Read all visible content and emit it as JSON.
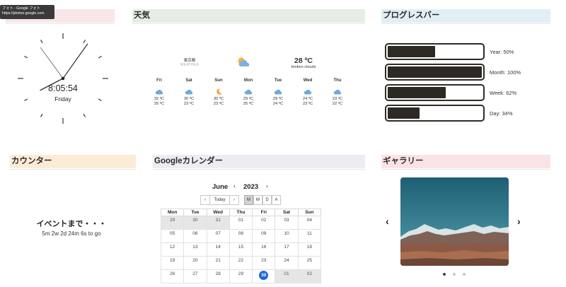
{
  "tooltip": {
    "title": "フォト - Google フォト",
    "url": "https://photos.google.com"
  },
  "sections": {
    "clock": "",
    "weather": "天気",
    "progress": "プログレスバー",
    "counter": "カウンター",
    "calendar": "Googleカレンダー",
    "gallery": "ギャラリー"
  },
  "clock": {
    "time": "8:05:54",
    "day": "Friday",
    "hour": 8,
    "minute": 5,
    "second": 54
  },
  "weather": {
    "location": "東京都",
    "location_sub": "WEATHER",
    "temp": "28 ºC",
    "description": "broken clouds",
    "main_icon": "partly-cloudy-icon",
    "days": [
      {
        "name": "Fri",
        "icon": "cloud-icon",
        "hi": "32 ºC",
        "lo": "25 ºC"
      },
      {
        "name": "Sat",
        "icon": "cloud-icon",
        "hi": "30 ºC",
        "lo": "23 ºC"
      },
      {
        "name": "Sun",
        "icon": "moon-icon",
        "hi": "30 ºC",
        "lo": "23 ºC"
      },
      {
        "name": "Mon",
        "icon": "cloud-icon",
        "hi": "29 ºC",
        "lo": "25 ºC"
      },
      {
        "name": "Tue",
        "icon": "cloud-icon",
        "hi": "29 ºC",
        "lo": "24 ºC"
      },
      {
        "name": "Wed",
        "icon": "cloud-icon",
        "hi": "24 ºC",
        "lo": "23 ºC"
      },
      {
        "name": "Thu",
        "icon": "cloud-icon",
        "hi": "23 ºC",
        "lo": "22 ºC"
      }
    ]
  },
  "progress": [
    {
      "label": "Year: 50%",
      "value": 0.5
    },
    {
      "label": "Month: 100%",
      "value": 1.0
    },
    {
      "label": "Week: 62%",
      "value": 0.62
    },
    {
      "label": "Day: 34%",
      "value": 0.34
    }
  ],
  "counter": {
    "title": "イベントまで・・・",
    "remaining": "5m 2w 2d 24m 6s to go"
  },
  "calendar": {
    "month": "June",
    "year": "2023",
    "prev": "‹",
    "next": "›",
    "today_label": "Today",
    "views": [
      {
        "label": "M",
        "active": true
      },
      {
        "label": "W",
        "active": false
      },
      {
        "label": "D",
        "active": false
      },
      {
        "label": "A",
        "active": false
      }
    ],
    "weekdays": [
      "Mon",
      "Tue",
      "Wed",
      "Thu",
      "Fri",
      "Sat",
      "Sun"
    ],
    "weeks": [
      [
        {
          "d": "29",
          "m": true
        },
        {
          "d": "30",
          "m": true
        },
        {
          "d": "31",
          "m": true
        },
        {
          "d": "01"
        },
        {
          "d": "02"
        },
        {
          "d": "03"
        },
        {
          "d": "04"
        }
      ],
      [
        {
          "d": "05"
        },
        {
          "d": "06"
        },
        {
          "d": "07"
        },
        {
          "d": "08"
        },
        {
          "d": "09"
        },
        {
          "d": "10"
        },
        {
          "d": "11"
        }
      ],
      [
        {
          "d": "12"
        },
        {
          "d": "13"
        },
        {
          "d": "14"
        },
        {
          "d": "15"
        },
        {
          "d": "16"
        },
        {
          "d": "17"
        },
        {
          "d": "18"
        }
      ],
      [
        {
          "d": "19"
        },
        {
          "d": "20"
        },
        {
          "d": "21"
        },
        {
          "d": "22"
        },
        {
          "d": "23"
        },
        {
          "d": "24"
        },
        {
          "d": "25"
        }
      ],
      [
        {
          "d": "26"
        },
        {
          "d": "27"
        },
        {
          "d": "28"
        },
        {
          "d": "29"
        },
        {
          "d": "30",
          "today": true
        },
        {
          "d": "01",
          "m": true
        },
        {
          "d": "02",
          "m": true
        }
      ]
    ]
  },
  "gallery": {
    "prev": "‹",
    "next": "›",
    "slide_count": 3,
    "active_slide": 0
  },
  "colors": {
    "clock_head": "#f8e6e8",
    "weather_head": "#e5ede4",
    "progress_head": "#e1eef6",
    "counter_head": "#fbecd7",
    "calendar_head": "#eeebf3",
    "gallery_head": "#fbe3e6",
    "today": "#1e69d2"
  }
}
